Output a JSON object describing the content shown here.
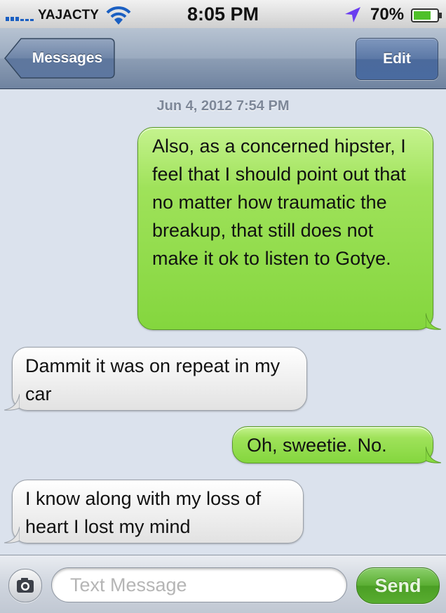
{
  "status_bar": {
    "carrier": "YAJACTY",
    "time": "8:05 PM",
    "battery": "70%",
    "icons": [
      "signal-icon",
      "wifi-icon",
      "location-icon",
      "battery-icon"
    ]
  },
  "nav": {
    "back_label": "Messages",
    "edit_label": "Edit"
  },
  "conversation": {
    "timestamp": "Jun 4, 2012 7:54 PM",
    "messages": [
      {
        "direction": "outgoing",
        "text": "Also, as a concerned hipster, I feel that I should point out that no matter how traumatic the breakup, that still does not make it ok to listen to Gotye."
      },
      {
        "direction": "incoming",
        "text": "Dammit it was on repeat in my car"
      },
      {
        "direction": "outgoing",
        "text": "Oh, sweetie. No."
      },
      {
        "direction": "incoming",
        "text": "I know along with my loss of heart I lost my mind"
      }
    ]
  },
  "composer": {
    "placeholder": "Text Message",
    "value": "",
    "send_label": "Send",
    "camera_icon": "camera-icon"
  },
  "colors": {
    "outgoing_bubble": "#8edb4a",
    "incoming_bubble": "#efefef",
    "background": "#dbe2ed",
    "navbar": "#6f83a0"
  }
}
